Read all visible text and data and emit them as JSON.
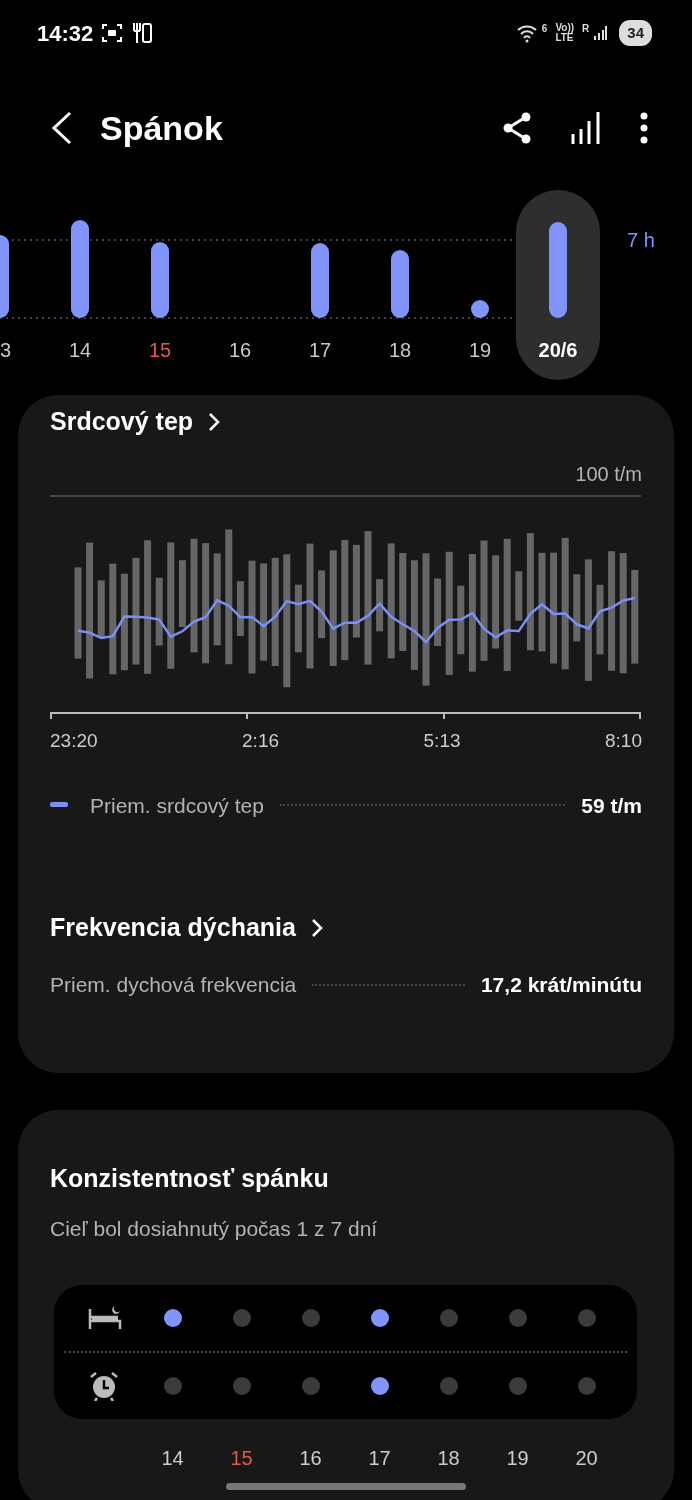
{
  "status_bar": {
    "time": "14:32",
    "wifi_badge": "6",
    "volte": "Vo))",
    "lte": "LTE",
    "roaming": "R",
    "battery": "34"
  },
  "header": {
    "title": "Spánok"
  },
  "sleep_chart": {
    "goal_label": "7 h",
    "days": [
      {
        "label": "3",
        "selected": false,
        "sunday": false
      },
      {
        "label": "14",
        "selected": false,
        "sunday": false
      },
      {
        "label": "15",
        "selected": false,
        "sunday": true
      },
      {
        "label": "16",
        "selected": false,
        "sunday": false
      },
      {
        "label": "17",
        "selected": false,
        "sunday": false
      },
      {
        "label": "18",
        "selected": false,
        "sunday": false
      },
      {
        "label": "19",
        "selected": false,
        "sunday": false
      },
      {
        "label": "20/6",
        "selected": true,
        "sunday": false
      }
    ]
  },
  "heart_rate": {
    "title": "Srdcový tep",
    "max_label": "100 t/m",
    "times": [
      "23:20",
      "2:16",
      "5:13",
      "8:10"
    ],
    "legend": "Priem. srdcový tep",
    "value": "59 t/m"
  },
  "breathing": {
    "title": "Frekvencia dýchania",
    "label": "Priem. dychová frekvencia",
    "value": "17,2 krát/minútu"
  },
  "consistency": {
    "title": "Konzistentnosť spánku",
    "summary": "Cieľ bol dosiahnutý počas 1 z 7 dní",
    "days": [
      {
        "label": "14",
        "sunday": false,
        "bedtime_met": true,
        "wake_met": false
      },
      {
        "label": "15",
        "sunday": true,
        "bedtime_met": false,
        "wake_met": false
      },
      {
        "label": "16",
        "sunday": false,
        "bedtime_met": false,
        "wake_met": false
      },
      {
        "label": "17",
        "sunday": false,
        "bedtime_met": true,
        "wake_met": true
      },
      {
        "label": "18",
        "sunday": false,
        "bedtime_met": false,
        "wake_met": false
      },
      {
        "label": "19",
        "sunday": false,
        "bedtime_met": false,
        "wake_met": false
      },
      {
        "label": "20",
        "sunday": false,
        "bedtime_met": false,
        "wake_met": false
      }
    ]
  }
}
